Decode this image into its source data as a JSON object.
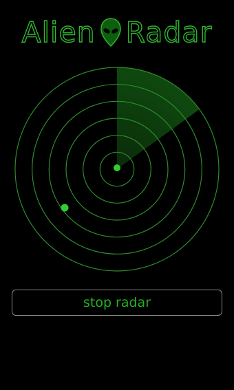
{
  "app": {
    "title_word_1": "Alien",
    "title_word_2": "Radar",
    "title_icon": "alien-head-icon",
    "accent_color": "#2fb52f"
  },
  "radar": {
    "ring_count": 6,
    "ring_color": "#2e8b2e",
    "sweep_color": "#0d3a0d",
    "blip_color": "#33cc33",
    "blips": [
      {
        "name": "center-blip"
      },
      {
        "name": "target-blip"
      }
    ]
  },
  "controls": {
    "stop_label": "stop radar",
    "button_border_color": "#8a8a8a"
  }
}
